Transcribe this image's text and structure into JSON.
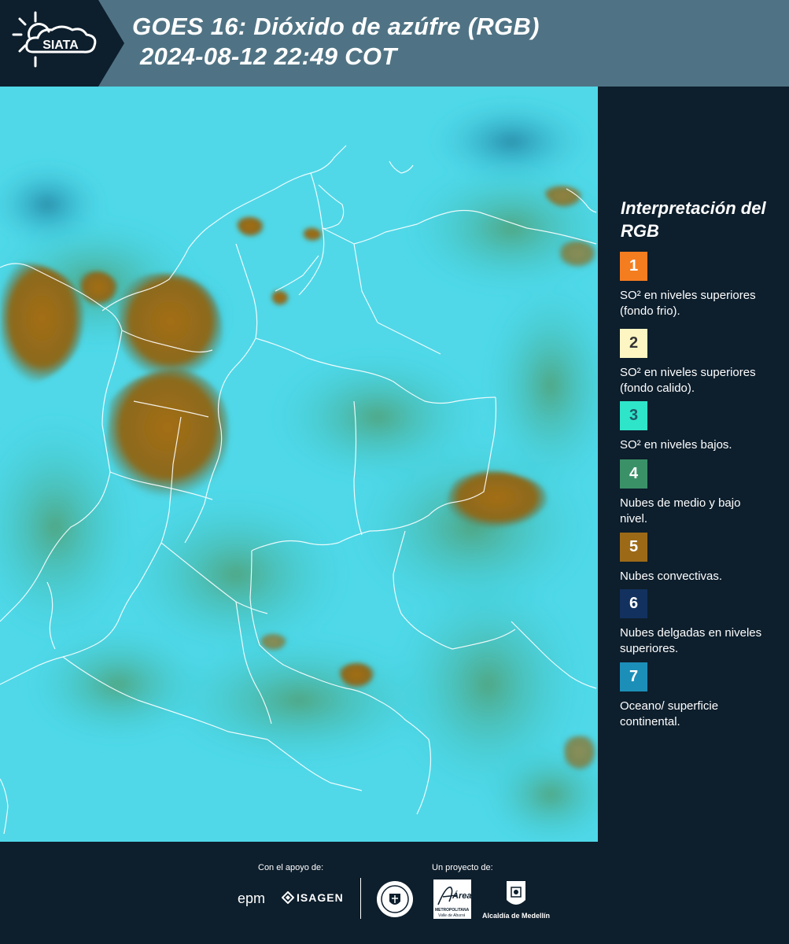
{
  "header": {
    "logo_text": "SIATA",
    "title_line1": "GOES 16: Dióxido de azúfre (RGB)",
    "title_line2": "2024-08-12 22:49 COT"
  },
  "legend": {
    "title": "Interpretación del RGB",
    "items": [
      {
        "number": "1",
        "color": "#f47d20",
        "text_color": "#ffffff",
        "description": "SO² en niveles superiores (fondo frio)."
      },
      {
        "number": "2",
        "color": "#fdf6c3",
        "text_color": "#333333",
        "description": "SO² en niveles superiores (fondo calido)."
      },
      {
        "number": "3",
        "color": "#2fe5c9",
        "text_color": "#1c5a6a",
        "description": "SO² en niveles bajos."
      },
      {
        "number": "4",
        "color": "#3a9168",
        "text_color": "#ffffff",
        "description": "Nubes de medio y bajo nivel."
      },
      {
        "number": "5",
        "color": "#9c6a17",
        "text_color": "#ffffff",
        "description": "Nubes convectivas."
      },
      {
        "number": "6",
        "color": "#12315e",
        "text_color": "#ffffff",
        "description": "Nubes delgadas en niveles superiores."
      },
      {
        "number": "7",
        "color": "#1c8fb8",
        "text_color": "#ffffff",
        "description": "Oceano/ superficie continental."
      }
    ]
  },
  "footer": {
    "support_label": "Con el apoyo de:",
    "project_label": "Un proyecto de:",
    "sponsor_epm": "epm",
    "sponsor_isagen": "ISAGEN",
    "partner_area_text": "Área",
    "partner_area_sub": "METROPOLITANA",
    "partner_area_sub2": "Valle de Aburrá",
    "partner_alcaldia": "Alcaldía de Medellín"
  },
  "colors": {
    "header_bg": "#4f7384",
    "panel_bg": "#0d1e2c",
    "surface_cyan": "#37d3e6",
    "cloud_brown": "#9c6a17",
    "cloud_green": "#3a9168"
  }
}
